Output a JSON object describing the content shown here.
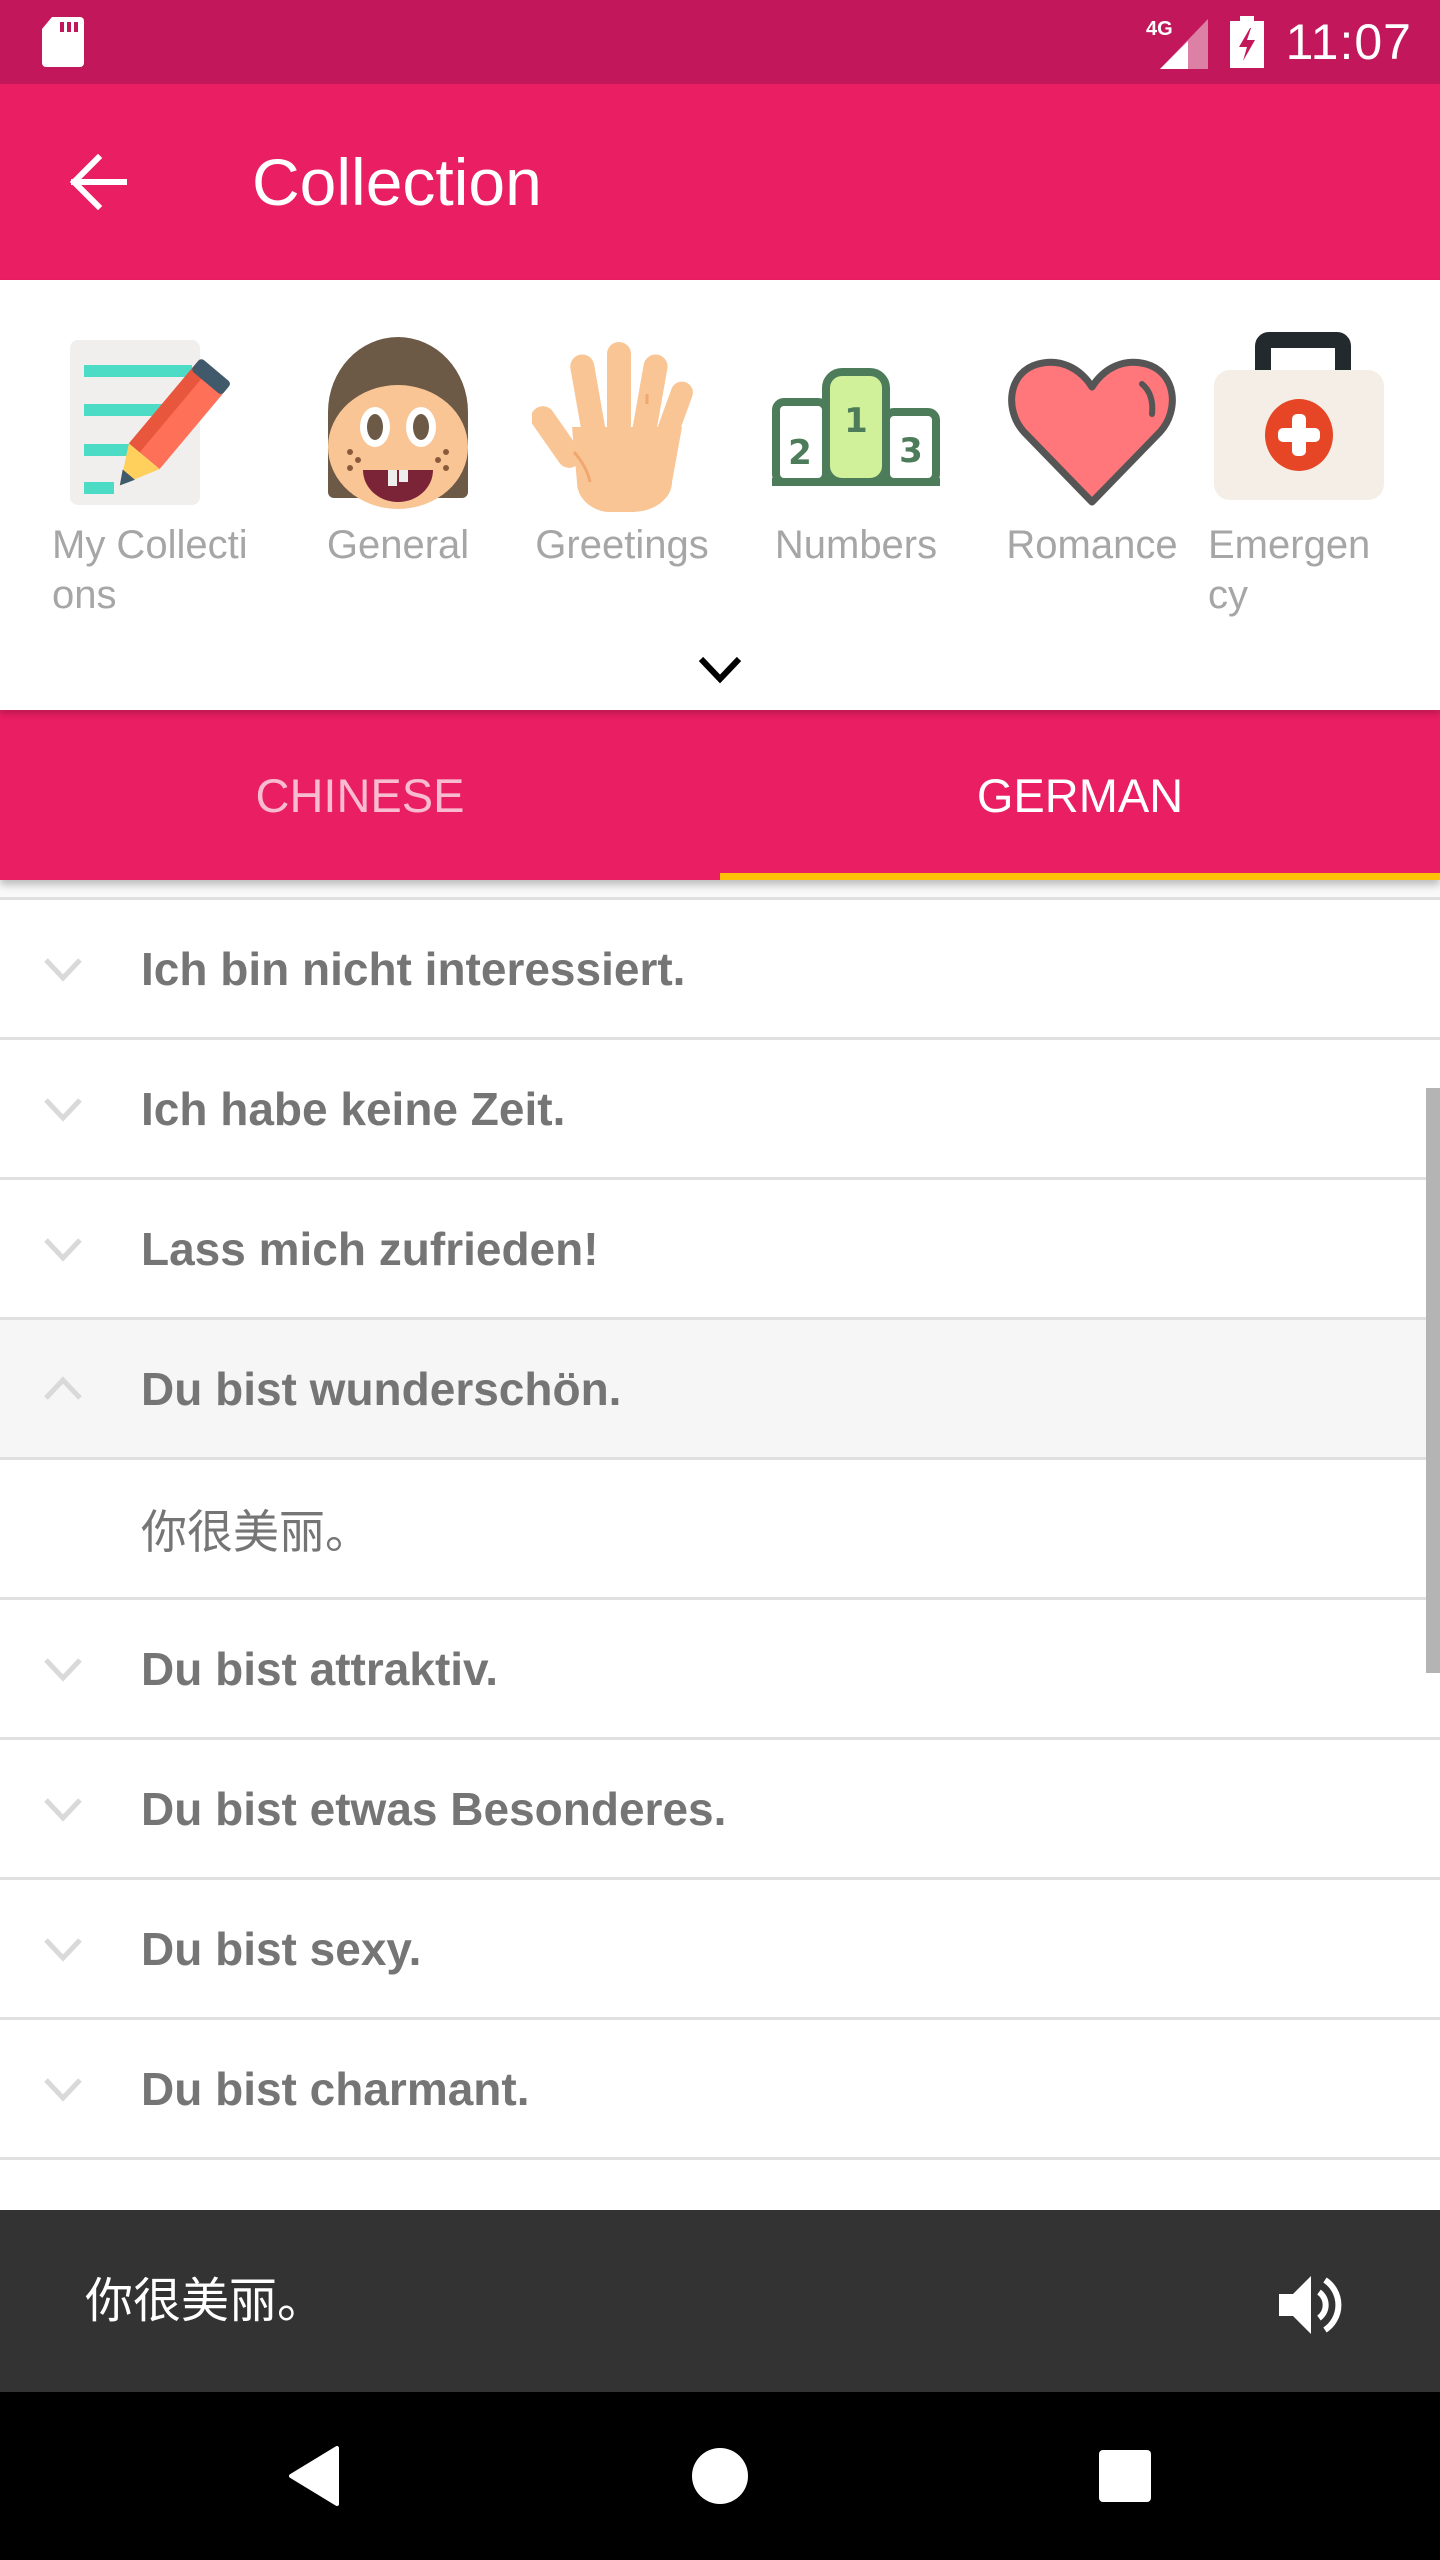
{
  "status_bar": {
    "time": "11:07",
    "network": "4G",
    "icons": [
      "sd-card-icon",
      "signal-4g-icon",
      "battery-charging-icon"
    ]
  },
  "app_bar": {
    "title": "Collection",
    "back_icon": "arrow-back-icon"
  },
  "categories": [
    {
      "label": "My Collections",
      "icon": "notepad-pencil-icon"
    },
    {
      "label": "General",
      "icon": "face-icon"
    },
    {
      "label": "Greetings",
      "icon": "waving-hand-icon"
    },
    {
      "label": "Numbers",
      "icon": "podium-icon"
    },
    {
      "label": "Romance",
      "icon": "heart-icon"
    },
    {
      "label": "Emergency",
      "icon": "first-aid-kit-icon"
    }
  ],
  "expand_icon": "chevron-down-icon",
  "tabs": [
    {
      "label": "CHINESE",
      "selected": false
    },
    {
      "label": "GERMAN",
      "selected": true
    }
  ],
  "colors": {
    "status_bar": "#c2185b",
    "primary": "#e91e63",
    "tab_indicator": "#ffc107",
    "player_bg": "#333333"
  },
  "phrases": [
    {
      "text": "Ich bin nicht interessiert.",
      "expanded": false
    },
    {
      "text": "Ich habe keine Zeit.",
      "expanded": false
    },
    {
      "text": "Lass mich zufrieden!",
      "expanded": false
    },
    {
      "text": "Du bist wunderschön.",
      "expanded": true,
      "translation": "你很美丽。"
    },
    {
      "text": "Du bist attraktiv.",
      "expanded": false
    },
    {
      "text": "Du bist etwas Besonderes.",
      "expanded": false
    },
    {
      "text": "Du bist sexy.",
      "expanded": false
    },
    {
      "text": "Du bist charmant.",
      "expanded": false
    }
  ],
  "player": {
    "text": "你很美丽。",
    "icon": "speaker-icon"
  },
  "nav_bar": {
    "buttons": [
      "back-nav-icon",
      "home-nav-icon",
      "recents-nav-icon"
    ]
  }
}
